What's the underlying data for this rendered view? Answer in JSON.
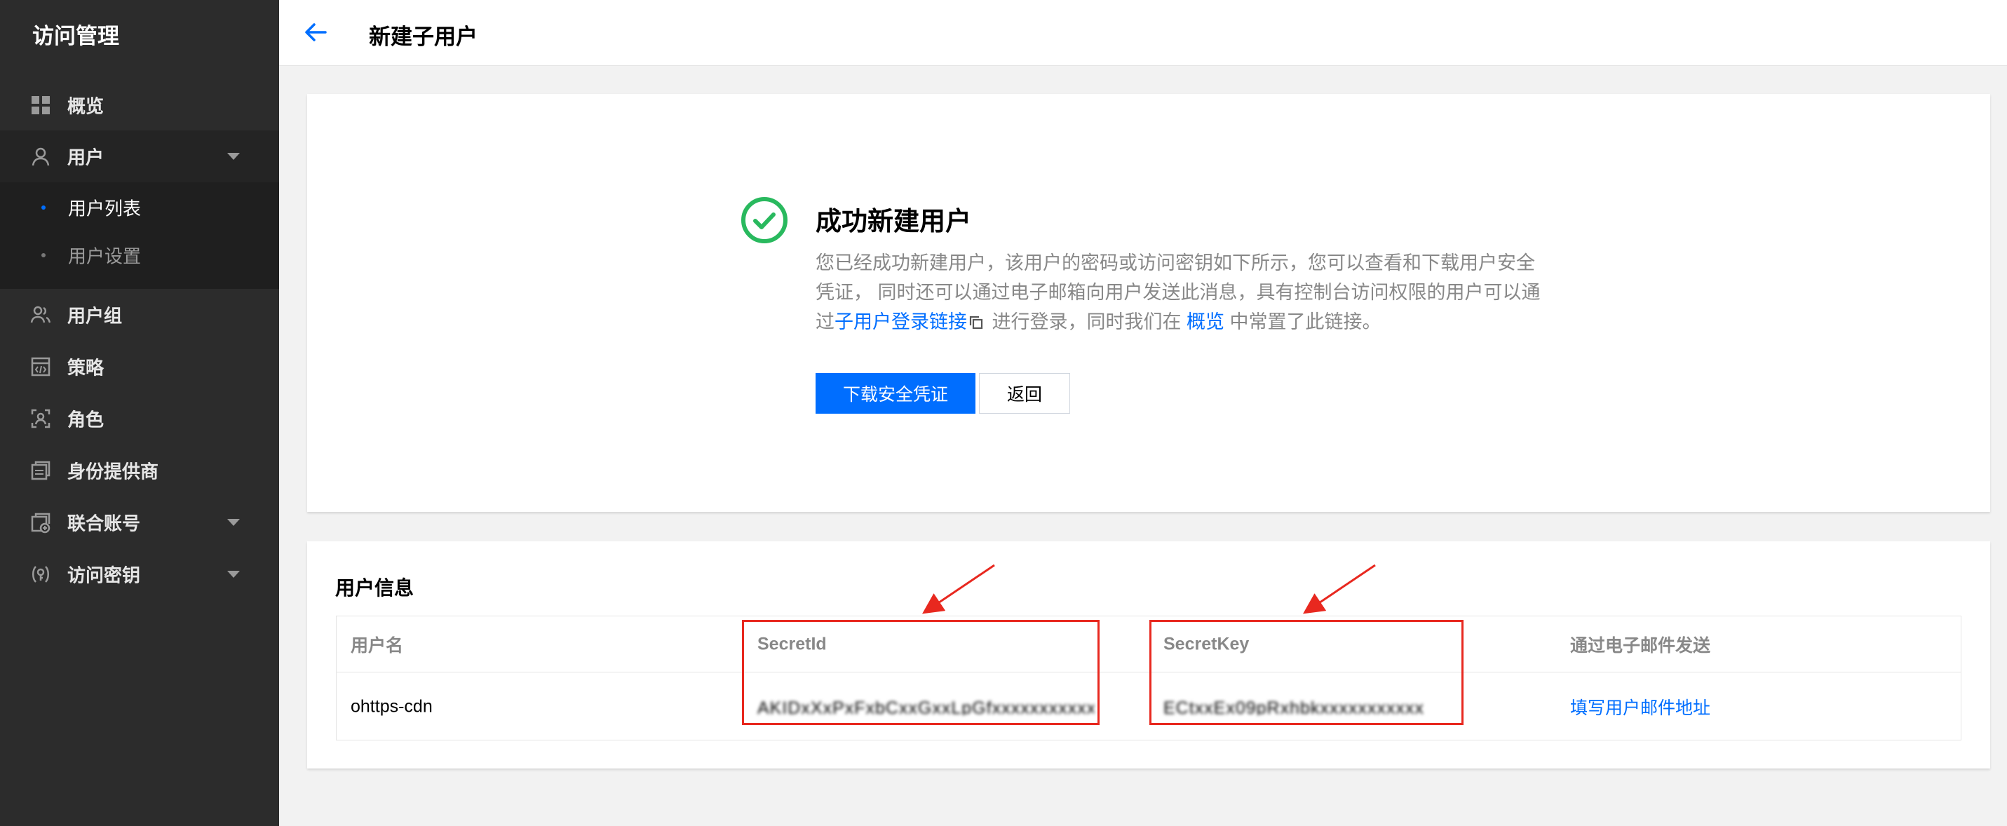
{
  "sidebar": {
    "brand": "访问管理",
    "items": [
      {
        "label": "概览",
        "icon": "grid-icon"
      },
      {
        "label": "用户",
        "icon": "user-icon",
        "expanded": true
      },
      {
        "label": "用户组",
        "icon": "user-group-icon"
      },
      {
        "label": "策略",
        "icon": "policy-icon"
      },
      {
        "label": "角色",
        "icon": "role-icon"
      },
      {
        "label": "身份提供商",
        "icon": "identity-provider-icon"
      },
      {
        "label": "联合账号",
        "icon": "federated-account-icon"
      },
      {
        "label": "访问密钥",
        "icon": "access-key-icon"
      }
    ],
    "user_submenu": [
      {
        "label": "用户列表",
        "active": true
      },
      {
        "label": "用户设置",
        "active": false
      }
    ]
  },
  "header": {
    "title": "新建子用户"
  },
  "success": {
    "title": "成功新建用户",
    "desc_before_link": "您已经成功新建用户，该用户的密码或访问密钥如下所示，您可以查看和下载用户安全凭证， 同时还可以通过电子邮箱向用户发送此消息，具有控制台访问权限的用户可以通过",
    "login_link": "子用户登录链接",
    "desc_middle": " 进行登录，同时我们在 ",
    "overview_link": "概览",
    "desc_end": " 中常置了此链接。",
    "download_button": "下载安全凭证",
    "back_button": "返回"
  },
  "user_info": {
    "title": "用户信息",
    "columns": [
      "用户名",
      "SecretId",
      "SecretKey",
      "通过电子邮件发送"
    ],
    "rows": [
      {
        "username": "ohttps-cdn",
        "secret_id": "AKIDxXxPxFxbCxxGxxLpGfxxxxxxxxxxxxxxx",
        "secret_key": "ECtxxEx09pRxhbkxxxxxxxxxxx",
        "email_action": "填写用户邮件地址"
      }
    ]
  },
  "colors": {
    "primary": "#006eff",
    "success": "#29b95e",
    "annotation": "#e8281f",
    "sidebar_bg": "#2c2c2c"
  }
}
